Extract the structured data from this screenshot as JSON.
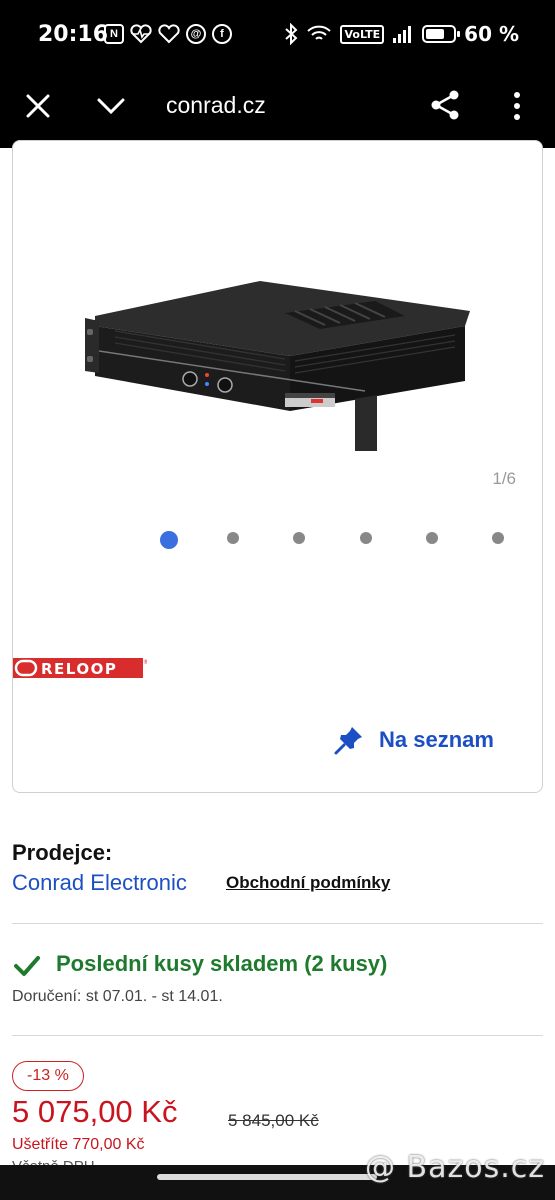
{
  "status_bar": {
    "time": "20:16",
    "left_icons": [
      "nfc-icon",
      "heart-rate-icon",
      "heart-icon",
      "threads-icon",
      "facebook-icon"
    ],
    "volte": "VoLTE",
    "battery": "60 %"
  },
  "toolbar": {
    "url": "conrad.cz"
  },
  "gallery": {
    "counter": "1/6",
    "total_images": 6,
    "active_index": 0
  },
  "brand": {
    "name": "RELOOP"
  },
  "wishlist": {
    "label": "Na seznam"
  },
  "seller": {
    "label": "Prodejce:",
    "name": "Conrad Electronic",
    "terms_link": "Obchodní podmínky"
  },
  "stock": {
    "status": "Poslední kusy skladem (2 kusy)",
    "delivery": "Doručení: st 07.01. - st 14.01."
  },
  "price": {
    "discount": "-13 %",
    "current": "5 075,00 Kč",
    "old": "5 845,00 Kč",
    "savings": "Ušetříte 770,00 Kč",
    "vat": "Včetně DPH"
  },
  "watermark": "@ Bazos.cz",
  "colors": {
    "accent_blue": "#1d4fc4",
    "stock_green": "#1e7a2d",
    "price_red": "#c8141e",
    "dot_active": "#3a6fe0"
  }
}
